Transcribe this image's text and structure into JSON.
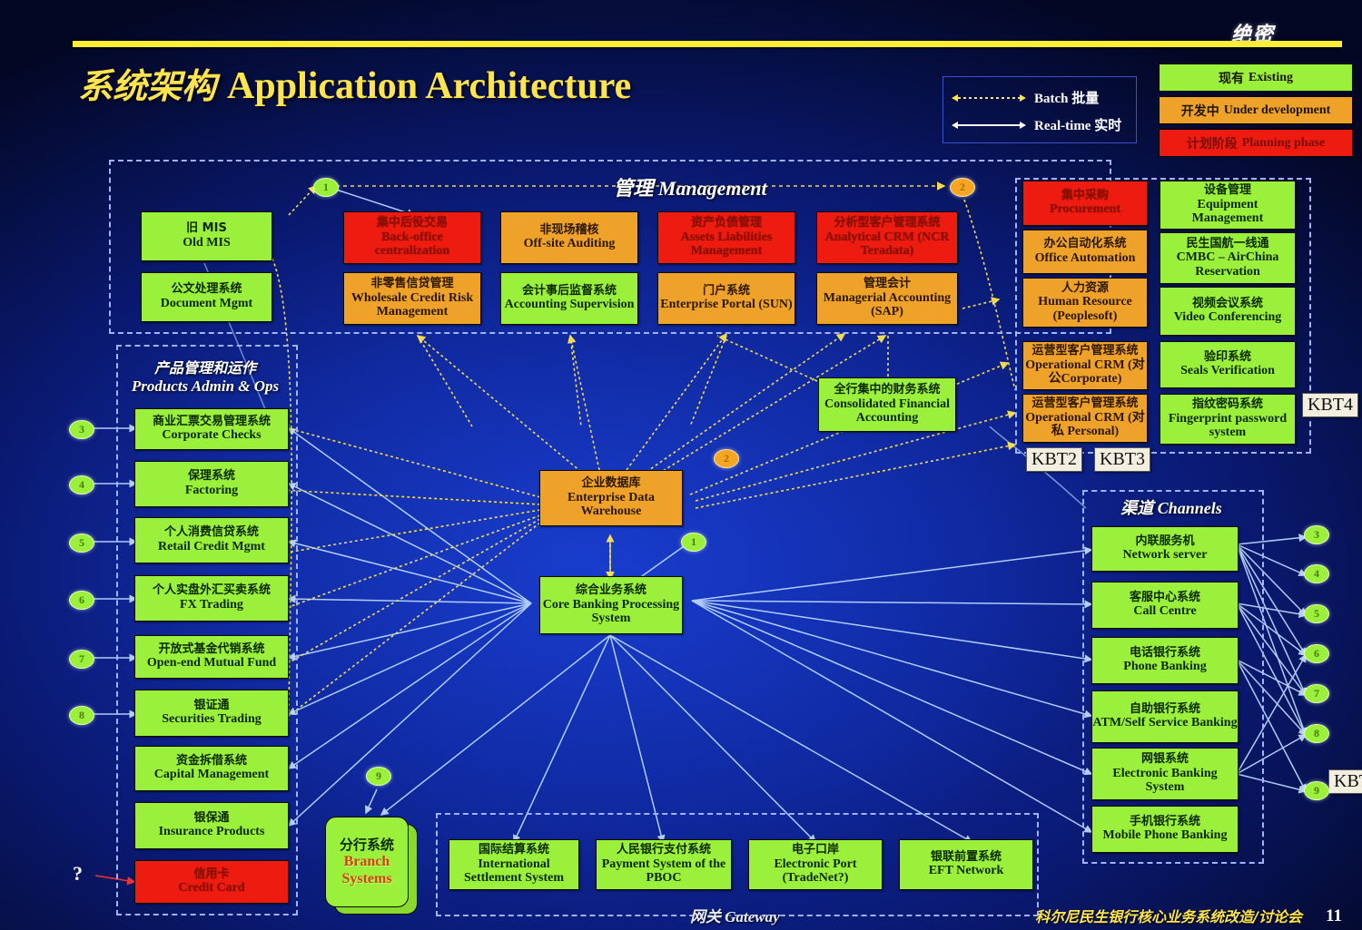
{
  "header": {
    "classification": "绝密",
    "title_zh": "系统架构",
    "title_en": "Application Architecture"
  },
  "legend": {
    "batch": "Batch 批量",
    "realtime": "Real-time 实时",
    "swatches": [
      {
        "label_zh": "现有",
        "label_en": "Existing",
        "color": "#9bf03c"
      },
      {
        "label_zh": "开发中",
        "label_en": "Under development",
        "color": "#efa229"
      },
      {
        "label_zh": "计划阶段",
        "label_en": "Planning phase",
        "color": "#ee1c10"
      }
    ]
  },
  "groups": {
    "management": {
      "title_zh": "管理",
      "title_en": "Management"
    },
    "products": {
      "title_zh": "产品管理和运作",
      "title_en": "Products Admin & Ops"
    },
    "channels": {
      "title_zh": "渠道",
      "title_en": "Channels"
    },
    "gateway": {
      "title_zh": "网关",
      "title_en": "Gateway"
    }
  },
  "management_nodes": [
    {
      "zh": "旧 MIS",
      "en": "Old MIS",
      "status": "green"
    },
    {
      "zh": "公文处理系统",
      "en": "Document Mgmt",
      "status": "green"
    },
    {
      "zh": "集中后役交易",
      "en": "Back-office centralization",
      "status": "red"
    },
    {
      "zh": "非零售信贷管理",
      "en": "Wholesale Credit Risk Management",
      "status": "orange"
    },
    {
      "zh": "非现场稽核",
      "en": "Off-site Auditing",
      "status": "orange"
    },
    {
      "zh": "会计事后监督系统",
      "en": "Accounting Supervision",
      "status": "green"
    },
    {
      "zh": "资产负债管理",
      "en": "Assets Liabilities Management",
      "status": "red"
    },
    {
      "zh": "门户系统",
      "en": "Enterprise Portal (SUN)",
      "status": "orange"
    },
    {
      "zh": "分析型客户管理系统",
      "en": "Analytical CRM (NCR Teradata)",
      "status": "red"
    },
    {
      "zh": "管理会计",
      "en": "Managerial Accounting (SAP)",
      "status": "orange"
    }
  ],
  "admin_nodes_left": [
    {
      "zh": "集中采购",
      "en": "Procurement",
      "status": "red"
    },
    {
      "zh": "办公自动化系统",
      "en": "Office Automation",
      "status": "orange"
    },
    {
      "zh": "人力资源",
      "en": "Human Resource (Peoplesoft)",
      "status": "orange"
    },
    {
      "zh": "运营型客户管理系统",
      "en": "Operational CRM (对公Corporate)",
      "status": "orange"
    },
    {
      "zh": "运营型客户管理系统",
      "en": "Operational CRM (对私 Personal)",
      "status": "orange"
    }
  ],
  "admin_nodes_right": [
    {
      "zh": "设备管理",
      "en": "Equipment Management",
      "status": "green"
    },
    {
      "zh": "民生国航一线通",
      "en": "CMBC – AirChina Reservation",
      "status": "green"
    },
    {
      "zh": "视频会议系统",
      "en": "Video Conferencing",
      "status": "green"
    },
    {
      "zh": "验印系统",
      "en": "Seals Verification",
      "status": "green"
    },
    {
      "zh": "指纹密码系统",
      "en": "Fingerprint password system",
      "status": "green"
    }
  ],
  "products_nodes": [
    {
      "zh": "商业汇票交易管理系统",
      "en": "Corporate Checks",
      "status": "green",
      "badge": "3"
    },
    {
      "zh": "保理系统",
      "en": "Factoring",
      "status": "green",
      "badge": "4"
    },
    {
      "zh": "个人消费信贷系统",
      "en": "Retail Credit Mgmt",
      "status": "green",
      "badge": "5"
    },
    {
      "zh": "个人实盘外汇买卖系统",
      "en": "FX Trading",
      "status": "green",
      "badge": "6"
    },
    {
      "zh": "开放式基金代销系统",
      "en": "Open-end Mutual Fund",
      "status": "green",
      "badge": "7"
    },
    {
      "zh": "银证通",
      "en": "Securities Trading",
      "status": "green",
      "badge": "8"
    },
    {
      "zh": "资金拆借系统",
      "en": "Capital Management",
      "status": "green",
      "badge": ""
    },
    {
      "zh": "银保通",
      "en": "Insurance Products",
      "status": "green",
      "badge": ""
    },
    {
      "zh": "信用卡",
      "en": "Credit Card",
      "status": "red",
      "badge": "?"
    }
  ],
  "channels_nodes": [
    {
      "zh": "内联服务机",
      "en": "Network server",
      "status": "green"
    },
    {
      "zh": "客服中心系统",
      "en": "Call Centre",
      "status": "green"
    },
    {
      "zh": "电话银行系统",
      "en": "Phone Banking",
      "status": "green"
    },
    {
      "zh": "自助银行系统",
      "en": "ATM/Self Service Banking",
      "status": "green"
    },
    {
      "zh": "网银系统",
      "en": "Electronic Banking System",
      "status": "green"
    },
    {
      "zh": "手机银行系统",
      "en": "Mobile Phone Banking",
      "status": "green"
    }
  ],
  "gateway_nodes": [
    {
      "zh": "国际结算系统",
      "en": "International Settlement System",
      "status": "green"
    },
    {
      "zh": "人民银行支付系统",
      "en": "Payment System of the PBOC",
      "status": "green"
    },
    {
      "zh": "电子口岸",
      "en": "Electronic Port (TradeNet?)",
      "status": "green"
    },
    {
      "zh": "银联前置系统",
      "en": "EFT Network",
      "status": "green"
    }
  ],
  "center_nodes": [
    {
      "zh": "全行集中的财务系统",
      "en": "Consolidated Financial Accounting",
      "status": "green"
    },
    {
      "zh": "企业数据库",
      "en": "Enterprise Data Warehouse",
      "status": "orange"
    },
    {
      "zh": "综合业务系统",
      "en": "Core Banking Processing System",
      "status": "green"
    }
  ],
  "branch": {
    "zh": "分行系统",
    "en_line1": "Branch",
    "en_line2": "Systems"
  },
  "kbt_tags": [
    "KBT2",
    "KBT3",
    "KBT4",
    "KBT"
  ],
  "badges": {
    "top_left": "1",
    "top_right": "2",
    "center_right": "2",
    "center_core": "1",
    "branch": "9",
    "left_column": [
      "3",
      "4",
      "5",
      "6",
      "7",
      "8"
    ],
    "right_column": [
      "3",
      "4",
      "5",
      "6",
      "7",
      "8",
      "9"
    ],
    "unknown": "?"
  },
  "footer": {
    "text": "科尔尼民生银行核心业务系统改造/讨论会",
    "page": "11"
  }
}
